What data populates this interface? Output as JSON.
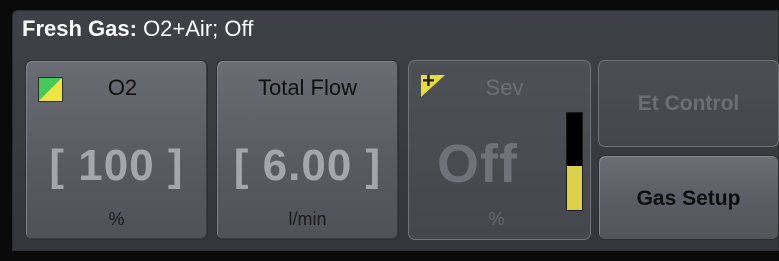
{
  "header": {
    "label": "Fresh Gas:",
    "status": "O2+Air; Off"
  },
  "tiles": {
    "o2": {
      "title": "O2",
      "value": "[ 100 ]",
      "unit": "%",
      "icon": "o2-color-swatch-icon",
      "colors": [
        "#46c85a",
        "#f0e442"
      ]
    },
    "total_flow": {
      "title": "Total Flow",
      "value": "[ 6.00 ]",
      "unit": "l/min"
    },
    "sev": {
      "title": "Sev",
      "value": "Off",
      "unit": "%",
      "icon": "sev-agent-plus-icon",
      "icon_glyph": "+",
      "level_fraction": 0.45,
      "level_color": "#dcd24a"
    }
  },
  "buttons": {
    "et_control": "Et Control",
    "gas_setup": "Gas Setup"
  }
}
